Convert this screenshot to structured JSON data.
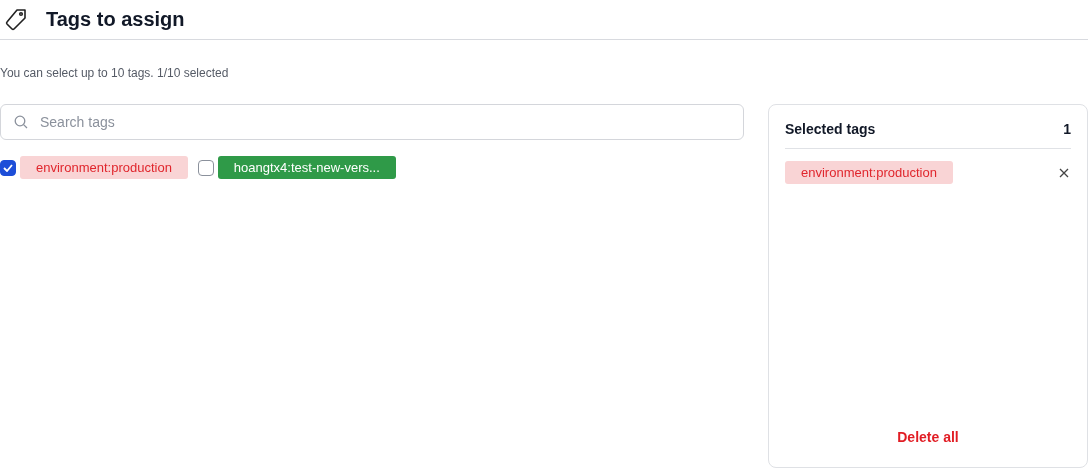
{
  "header": {
    "title": "Tags to assign"
  },
  "hint": "You can select up to 10 tags. 1/10 selected",
  "search": {
    "placeholder": "Search tags"
  },
  "tags": [
    {
      "label": "environment:production",
      "checked": true,
      "kind": "light",
      "color": "#e0262d"
    },
    {
      "label": "hoangtx4:test-new-vers...",
      "checked": false,
      "kind": "solid",
      "color": "#2f9a48"
    }
  ],
  "selected_panel": {
    "title": "Selected tags",
    "count": "1",
    "tags": [
      {
        "label": "environment:production",
        "kind": "light",
        "color": "#e0262d"
      }
    ],
    "delete_all": "Delete all"
  }
}
